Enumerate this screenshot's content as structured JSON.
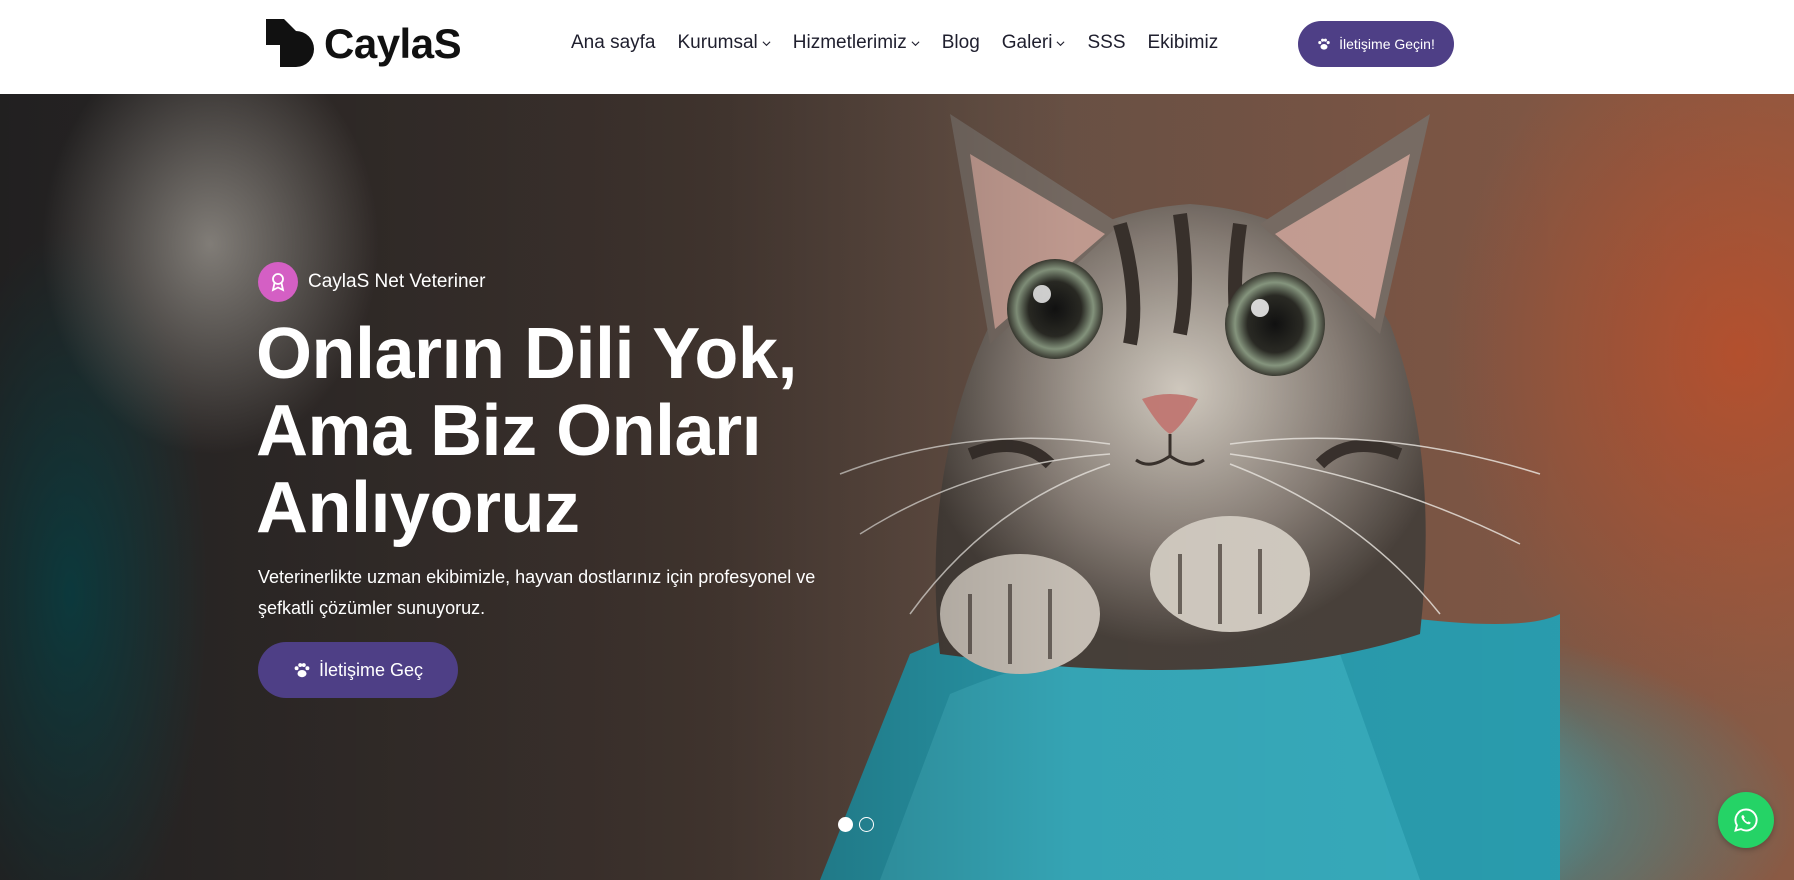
{
  "brand": {
    "name": "CaylaS"
  },
  "nav": {
    "items": [
      {
        "label": "Ana sayfa",
        "has_dropdown": false
      },
      {
        "label": "Kurumsal",
        "has_dropdown": true
      },
      {
        "label": "Hizmetlerimiz",
        "has_dropdown": true
      },
      {
        "label": "Blog",
        "has_dropdown": false
      },
      {
        "label": "Galeri",
        "has_dropdown": true
      },
      {
        "label": "SSS",
        "has_dropdown": false
      },
      {
        "label": "Ekibimiz",
        "has_dropdown": false
      }
    ],
    "cta_label": "İletişime Geçin!"
  },
  "hero": {
    "badge_label": "CaylaS Net Veteriner",
    "title_lines": [
      "Onların Dili Yok,",
      "Ama Biz Onları",
      "Anlıyoruz"
    ],
    "subtitle": "Veterinerlikte uzman ekibimizle, hayvan dostlarınız için profesyonel ve şefkatli çözümler sunuyoruz.",
    "cta_label": "İletişime Geç",
    "slides_total": 2,
    "active_slide": 1
  },
  "icons": {
    "cta_icon": "paw-icon",
    "badge_icon": "ribbon-icon",
    "floating": "whatsapp-icon"
  },
  "colors": {
    "accent": "#4e3f86",
    "badge": "#d45fc4",
    "whatsapp": "#25d366"
  }
}
